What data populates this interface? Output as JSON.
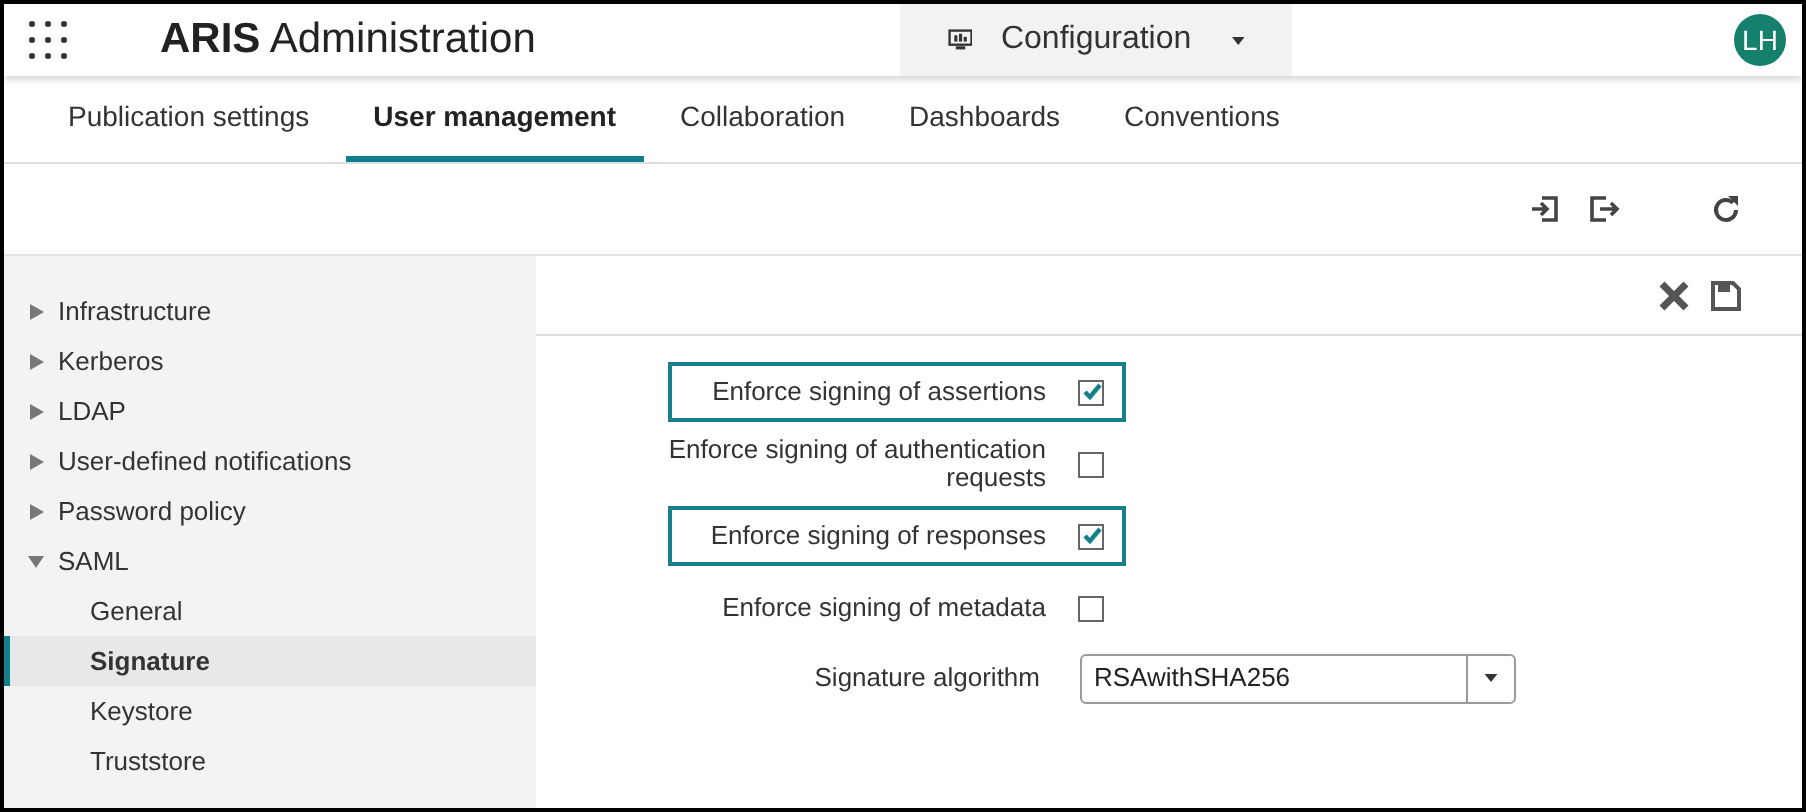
{
  "header": {
    "title_bold": "ARIS",
    "title": "Administration",
    "dropdown": "Configuration",
    "avatar": "LH"
  },
  "tabs": [
    {
      "label": "Publication settings",
      "selected": false
    },
    {
      "label": "User management",
      "selected": true
    },
    {
      "label": "Collaboration",
      "selected": false
    },
    {
      "label": "Dashboards",
      "selected": false
    },
    {
      "label": "Conventions",
      "selected": false
    }
  ],
  "sidebar": {
    "items": [
      {
        "label": "Infrastructure",
        "expanded": false,
        "selected": false
      },
      {
        "label": "Kerberos",
        "expanded": false,
        "selected": false
      },
      {
        "label": "LDAP",
        "expanded": false,
        "selected": false
      },
      {
        "label": "User-defined notifications",
        "expanded": false,
        "selected": false
      },
      {
        "label": "Password policy",
        "expanded": false,
        "selected": false
      },
      {
        "label": "SAML",
        "expanded": true,
        "selected": false,
        "children": [
          {
            "label": "General",
            "selected": false
          },
          {
            "label": "Signature",
            "selected": true
          },
          {
            "label": "Keystore",
            "selected": false
          },
          {
            "label": "Truststore",
            "selected": false
          }
        ]
      }
    ]
  },
  "form": {
    "rows": [
      {
        "kind": "checkbox",
        "label": "Enforce signing of assertions",
        "checked": true,
        "highlighted": true
      },
      {
        "kind": "checkbox",
        "label": "Enforce signing of authentication requests",
        "checked": false,
        "highlighted": false
      },
      {
        "kind": "checkbox",
        "label": "Enforce signing of responses",
        "checked": true,
        "highlighted": true
      },
      {
        "kind": "checkbox",
        "label": "Enforce signing of metadata",
        "checked": false,
        "highlighted": false
      },
      {
        "kind": "select",
        "label": "Signature algorithm",
        "value": "RSAwithSHA256"
      }
    ]
  }
}
